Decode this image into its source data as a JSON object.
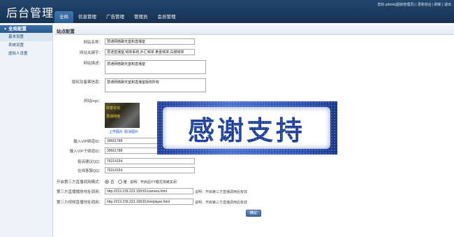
{
  "header": {
    "brand": "后台管理",
    "top_links": "您好,admin(超级管理员) | 更新前台 | 刷新 | 退出",
    "tabs": [
      {
        "label": "全局",
        "active": true
      },
      {
        "label": "信息管理",
        "active": false
      },
      {
        "label": "广告管理",
        "active": false
      },
      {
        "label": "管理员",
        "active": false
      },
      {
        "label": "会员管理",
        "active": false
      }
    ]
  },
  "sidebar": {
    "title": "全局配置",
    "items": [
      {
        "label": "基本设置",
        "active": true
      },
      {
        "label": "系统设置",
        "active": false
      },
      {
        "label": "虚拟人设置",
        "active": false
      }
    ]
  },
  "main": {
    "panel_title": "站点配置",
    "fields": {
      "site_name": {
        "label": "网站名称：",
        "value": "慧通网络聊天室和直播室"
      },
      "site_keywords": {
        "label": "网站关键字：",
        "value": "慧通直播室,喊单系统,外汇喊单,黄金喊单,白银喊单"
      },
      "site_description": {
        "label": "网站描述：",
        "value": "慧通网络聊天室和直播室"
      },
      "copyright": {
        "label": "版权及备案信息：",
        "value": "慧通网络聊天室和直播室版权所有"
      },
      "logo": {
        "label": "网站logo：",
        "line1": "财富论坛",
        "line2": "慧通网络",
        "upload_link": "上传图片",
        "cancel_link": "取消图片"
      },
      "vip_channel": {
        "label": "输入VIP频道ID：",
        "value": "39661788"
      },
      "vip_subchannel": {
        "label": "输入VIP子频道ID：",
        "value": "39661788"
      },
      "complaint_qq": {
        "label": "投诉建议QQ：",
        "value": "76314154"
      },
      "service_qq": {
        "label": "在线客服QQ：",
        "value": "76314154"
      },
      "third_party_mode": {
        "label": "开启第三方直播调用模式：",
        "options": [
          "否",
          "是"
        ],
        "selected": "否",
        "note": "说明：开启后YY模式将被关闭"
      },
      "third_party_play_url": {
        "label": "第三方直播播放地址调用：",
        "value": "http://219.239.223.158:81/camera.html",
        "note": "说明：开启第三方直播调用后有效"
      },
      "third_party_video_url": {
        "label": "第三方视频直播地址调用：",
        "value": "http://219.239.223.158:81/liveplayer.html",
        "note": "说明：开启第三方直播调用后有效"
      }
    },
    "submit_label": "确定"
  },
  "overlay": {
    "banner_text": "感谢支持"
  },
  "colors": {
    "header_bg": "#1b3a5f",
    "active_tab": "#2c5f93",
    "sidebar_bg": "#eef3f9",
    "banner_blue": "#1d3f99"
  }
}
